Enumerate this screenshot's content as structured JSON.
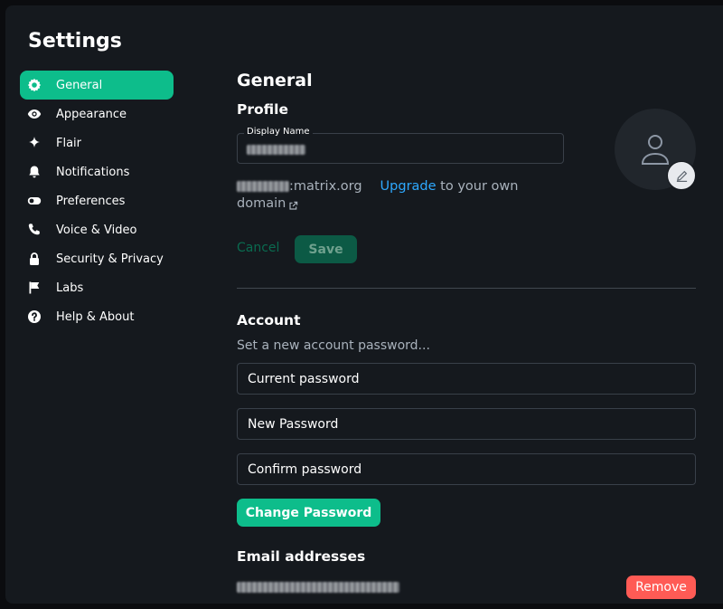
{
  "dialog": {
    "title": "Settings"
  },
  "sidebar": {
    "items": [
      {
        "label": "General",
        "icon": "gear-icon",
        "active": true
      },
      {
        "label": "Appearance",
        "icon": "eye-icon",
        "active": false
      },
      {
        "label": "Flair",
        "icon": "sparkle-icon",
        "active": false
      },
      {
        "label": "Notifications",
        "icon": "bell-icon",
        "active": false
      },
      {
        "label": "Preferences",
        "icon": "toggle-icon",
        "active": false
      },
      {
        "label": "Voice & Video",
        "icon": "phone-icon",
        "active": false
      },
      {
        "label": "Security & Privacy",
        "icon": "lock-icon",
        "active": false
      },
      {
        "label": "Labs",
        "icon": "flag-icon",
        "active": false
      },
      {
        "label": "Help & About",
        "icon": "help-icon",
        "active": false
      }
    ]
  },
  "general": {
    "title": "General",
    "profile": {
      "title": "Profile",
      "display_name_label": "Display Name",
      "mxid_suffix": ":matrix.org",
      "upgrade_link": "Upgrade",
      "upgrade_text": " to your own",
      "domain_text": "domain",
      "cancel_label": "Cancel",
      "save_label": "Save"
    },
    "account": {
      "title": "Account",
      "description": "Set a new account password...",
      "current_password_placeholder": "Current password",
      "new_password_placeholder": "New Password",
      "confirm_password_placeholder": "Confirm password",
      "change_password_label": "Change Password"
    },
    "email": {
      "title": "Email addresses",
      "remove_label": "Remove"
    }
  },
  "colors": {
    "accent": "#0dbd8b",
    "link": "#2ea9ff",
    "danger": "#ff5b55",
    "background": "#15191e"
  }
}
